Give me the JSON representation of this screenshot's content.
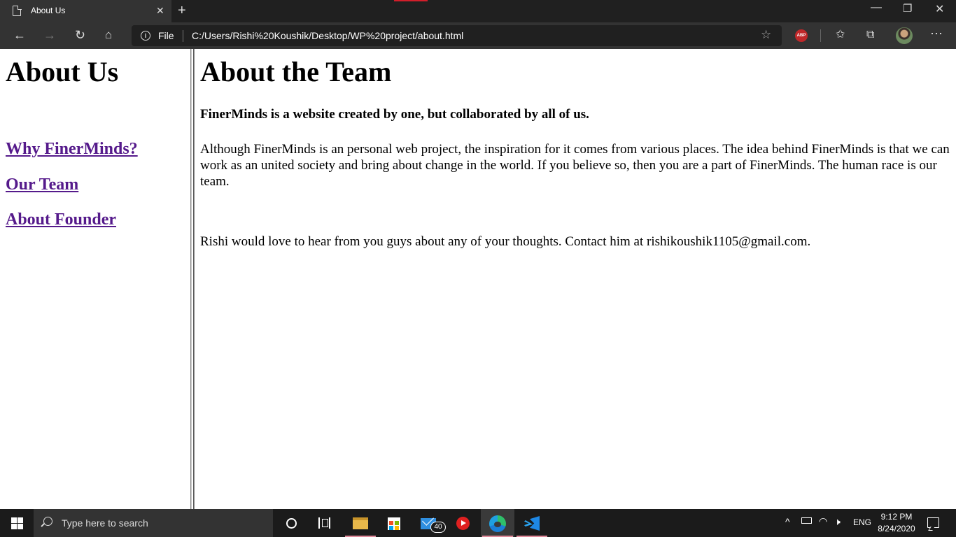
{
  "browser": {
    "tab_title": "About Us",
    "tab_close": "✕",
    "new_tab": "+",
    "address_scheme_label": "File",
    "address_url": "C:/Users/Rishi%20Koushik/Desktop/WP%20project/about.html",
    "extension_abp_label": "ABP",
    "accent_color": "#d21e2a"
  },
  "page": {
    "left": {
      "title": "About Us",
      "links": [
        {
          "label": "Why FinerMinds?"
        },
        {
          "label": "Our Team"
        },
        {
          "label": "About Founder"
        }
      ],
      "link_color": "#551a8b"
    },
    "right": {
      "title": "About the Team",
      "tagline": "FinerMinds is a website created by one, but collaborated by all of us.",
      "paragraph": "Although FinerMinds is an personal web project, the inspiration for it comes from various places. The idea behind FinerMinds is that we can work as an united society and bring about change in the world. If you believe so, then you are a part of FinerMinds. The human race is our team.",
      "contact": "Rishi would love to hear from you guys about any of your thoughts. Contact him at rishikoushik1105@gmail.com."
    }
  },
  "taskbar": {
    "search_placeholder": "Type here to search",
    "mail_badge": "40",
    "language": "ENG",
    "time": "9:12 PM",
    "date": "8/24/2020"
  }
}
